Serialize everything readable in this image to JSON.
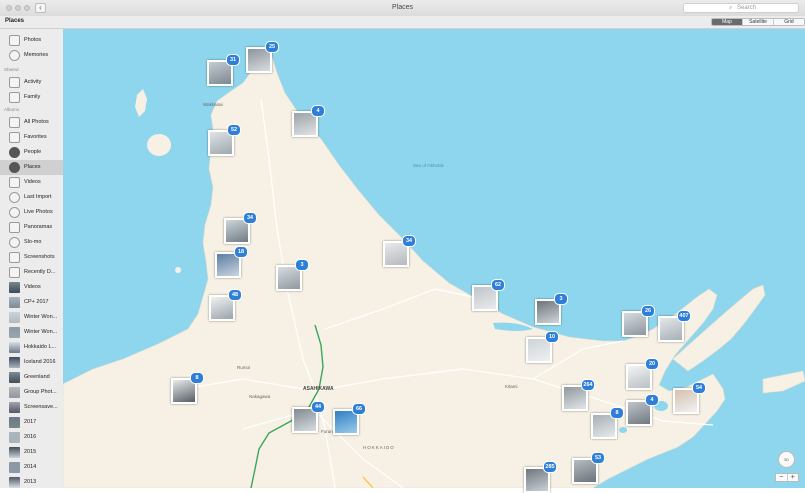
{
  "window": {
    "title": "Places",
    "back_icon": "chevron-left-icon"
  },
  "search": {
    "placeholder": "Search"
  },
  "toolbar": {
    "title": "Places",
    "view_modes": [
      "Map",
      "Satellite",
      "Grid"
    ],
    "selected_mode": "Map"
  },
  "sidebar": {
    "headers": {
      "shared": "Shared",
      "albums": "Albums"
    },
    "items": [
      {
        "label": "Photos",
        "icon": "photos-icon"
      },
      {
        "label": "Memories",
        "icon": "memories-icon"
      },
      {
        "label": "Activity",
        "icon": "cloud-icon"
      },
      {
        "label": "Family",
        "icon": "cloud-icon"
      },
      {
        "label": "All Photos",
        "icon": "album-icon"
      },
      {
        "label": "Favorites",
        "icon": "heart-icon"
      },
      {
        "label": "People",
        "icon": "person-icon"
      },
      {
        "label": "Places",
        "icon": "map-pin-icon",
        "selected": true
      },
      {
        "label": "Videos",
        "icon": "video-icon"
      },
      {
        "label": "Last Import",
        "icon": "clock-icon"
      },
      {
        "label": "Live Photos",
        "icon": "live-photo-icon"
      },
      {
        "label": "Panoramas",
        "icon": "panorama-icon"
      },
      {
        "label": "Slo-mo",
        "icon": "slomo-icon"
      },
      {
        "label": "Screenshots",
        "icon": "screenshot-icon"
      },
      {
        "label": "Recently D...",
        "icon": "trash-icon"
      },
      {
        "label": "Videos",
        "icon": "album-thumbnail-icon"
      },
      {
        "label": "CP+ 2017",
        "icon": "album-thumbnail-icon"
      },
      {
        "label": "Winter Won...",
        "icon": "album-thumbnail-icon"
      },
      {
        "label": "Winter Won...",
        "icon": "album-thumbnail-icon"
      },
      {
        "label": "Hokkaido L...",
        "icon": "album-thumbnail-icon"
      },
      {
        "label": "Iceland 2016",
        "icon": "album-thumbnail-icon"
      },
      {
        "label": "Greenland",
        "icon": "album-thumbnail-icon"
      },
      {
        "label": "Group Phot...",
        "icon": "album-thumbnail-icon"
      },
      {
        "label": "Screensave...",
        "icon": "album-thumbnail-icon"
      },
      {
        "label": "2017",
        "icon": "album-thumbnail-icon"
      },
      {
        "label": "2016",
        "icon": "album-thumbnail-icon"
      },
      {
        "label": "2015",
        "icon": "album-thumbnail-icon"
      },
      {
        "label": "2014",
        "icon": "album-thumbnail-icon"
      },
      {
        "label": "2013",
        "icon": "album-thumbnail-icon"
      }
    ]
  },
  "map": {
    "labels": {
      "asahikawa": "ASAHIKAWA",
      "hokkaido": "HOKKAIDO",
      "wakkanai": "Wakkanai",
      "kitami": "Kitami",
      "furano": "Furano",
      "nakagawa": "Nakagawa",
      "okhotsk": "Sea of Okhotsk",
      "rumoi": "Rumoi"
    },
    "photo_clusters": [
      {
        "count": "31"
      },
      {
        "count": "25"
      },
      {
        "count": "4"
      },
      {
        "count": "52"
      },
      {
        "count": "34"
      },
      {
        "count": "34"
      },
      {
        "count": "18"
      },
      {
        "count": "3"
      },
      {
        "count": "48"
      },
      {
        "count": "62"
      },
      {
        "count": "3"
      },
      {
        "count": "26"
      },
      {
        "count": "407"
      },
      {
        "count": "10"
      },
      {
        "count": "20"
      },
      {
        "count": "8"
      },
      {
        "count": "264"
      },
      {
        "count": "54"
      },
      {
        "count": "8"
      },
      {
        "count": "4"
      },
      {
        "count": "44"
      },
      {
        "count": "66"
      },
      {
        "count": "285"
      },
      {
        "count": "53"
      }
    ],
    "zoom_out": "−",
    "zoom_in": "+",
    "compass": "3D"
  },
  "colors": {
    "water": "#8ed6ee",
    "land": "#f6f1e4",
    "badge": "#2f7fd8",
    "route": "#3aa65a",
    "selection": "#d0d0d0"
  }
}
